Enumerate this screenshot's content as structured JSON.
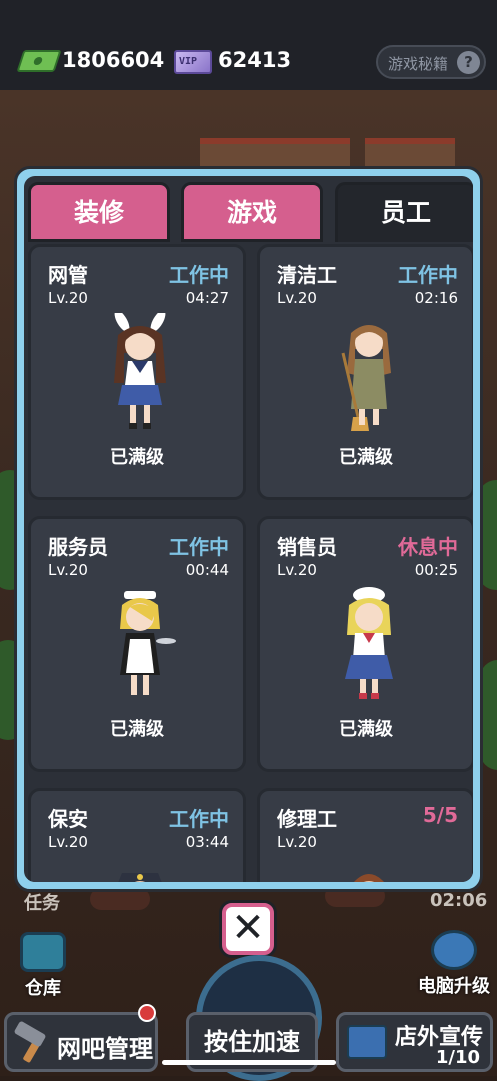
{
  "topbar": {
    "cash_value": "1806604",
    "vip_label": "VIP",
    "vip_value": "62413",
    "secret_button": "游戏秘籍",
    "help_glyph": "?"
  },
  "tabs": [
    {
      "label": "装修",
      "active": false
    },
    {
      "label": "游戏",
      "active": false
    },
    {
      "label": "员工",
      "active": true
    }
  ],
  "staff": [
    {
      "name": "网管",
      "status": "工作中",
      "level": "Lv.20",
      "time": "04:27",
      "note": "已满级",
      "status_type": "working"
    },
    {
      "name": "清洁工",
      "status": "工作中",
      "level": "Lv.20",
      "time": "02:16",
      "note": "已满级",
      "status_type": "working"
    },
    {
      "name": "服务员",
      "status": "工作中",
      "level": "Lv.20",
      "time": "00:44",
      "note": "已满级",
      "status_type": "working"
    },
    {
      "name": "销售员",
      "status": "休息中",
      "level": "Lv.20",
      "time": "00:25",
      "note": "已满级",
      "status_type": "resting"
    },
    {
      "name": "保安",
      "status": "工作中",
      "level": "Lv.20",
      "time": "03:44",
      "note": "",
      "status_type": "working"
    },
    {
      "name": "修理工",
      "status": "5/5",
      "level": "Lv.20",
      "time": "",
      "note": "",
      "status_type": "resting"
    }
  ],
  "bottom": {
    "task_label": "任务",
    "timer": "02:06",
    "warehouse_label": "仓库",
    "pc_upgrade_label": "电脑升级",
    "manage_label": "网吧管理",
    "hold_speed_label": "按住加速",
    "promo_label": "店外宣传",
    "promo_count": "1/10",
    "close_glyph": "✕"
  },
  "colors": {
    "working": "#7fc3e4",
    "resting": "#e06a98",
    "tab_pink": "#d55f8e",
    "panel_border": "#8fd0ec"
  }
}
